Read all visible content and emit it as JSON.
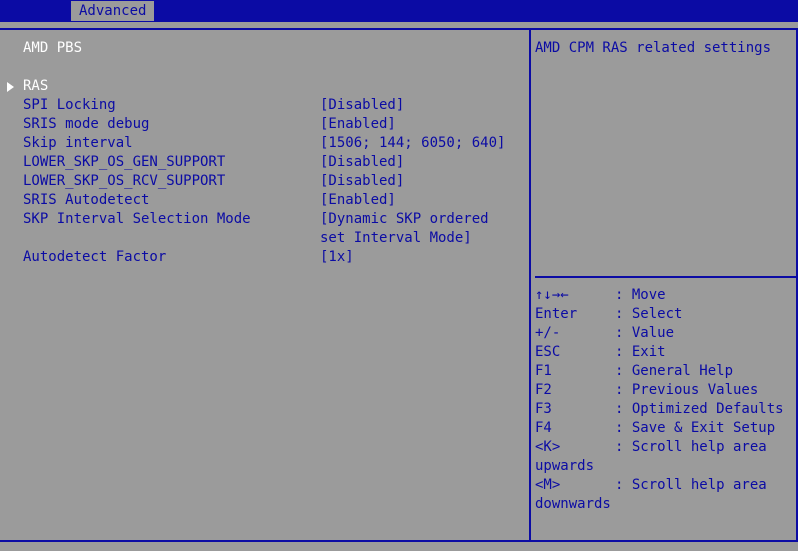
{
  "tabs": [
    {
      "label": "Advanced"
    }
  ],
  "page_title": "AMD PBS",
  "settings": [
    {
      "label": "RAS",
      "value": ""
    },
    {
      "label": "SPI Locking",
      "value": "[Disabled]"
    },
    {
      "label": "SRIS mode debug",
      "value": "[Enabled]"
    },
    {
      "label": "Skip interval",
      "value": "[1506; 144; 6050; 640]"
    },
    {
      "label": "LOWER_SKP_OS_GEN_SUPPORT",
      "value": "[Disabled]"
    },
    {
      "label": "LOWER_SKP_OS_RCV_SUPPORT",
      "value": "[Disabled]"
    },
    {
      "label": "SRIS Autodetect",
      "value": "[Enabled]"
    },
    {
      "label": "SKP Interval Selection Mode",
      "value": "[Dynamic SKP ordered",
      "value_line2": "set Interval Mode]"
    },
    {
      "label": "Autodetect Factor",
      "value": "[1x]"
    }
  ],
  "help_text": "AMD CPM RAS related settings",
  "keys": [
    {
      "key": "↑↓→←",
      "desc": ": Move"
    },
    {
      "key": "Enter",
      "desc": ": Select"
    },
    {
      "key": "+/-",
      "desc": ": Value"
    },
    {
      "key": "ESC",
      "desc": ": Exit"
    },
    {
      "key": "F1",
      "desc": ": General Help"
    },
    {
      "key": "F2",
      "desc": ": Previous Values"
    },
    {
      "key": "F3",
      "desc": ": Optimized Defaults"
    },
    {
      "key": "F4",
      "desc": ": Save & Exit Setup"
    },
    {
      "key": "<K>",
      "desc": ": Scroll help area",
      "desc_line2": "upwards"
    },
    {
      "key": "<M>",
      "desc": ": Scroll help area",
      "desc_line2": "downwards"
    }
  ],
  "colors": {
    "background": "#9b9b9b",
    "accent_blue": "#0b0ba4",
    "highlight": "#ffffff"
  }
}
